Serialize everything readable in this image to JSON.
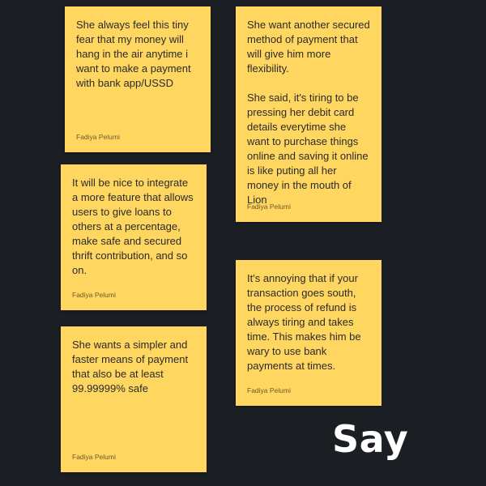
{
  "notes": [
    {
      "text": "She always feel this tiny fear that my money will hang in the air anytime i want to make a payment with bank app/USSD",
      "author": "Fadiya Pelumi"
    },
    {
      "text": "It will be nice to integrate a more feature that allows users to give loans to others at a percentage, make  safe and secured thrift contribution, and so on.",
      "author": "Fadiya Pelumi"
    },
    {
      "text": "She wants a simpler and faster means of payment that also be at least 99.99999% safe",
      "author": "Fadiya Pelumi"
    },
    {
      "text": "She want another secured method of payment that will give him more flexibility.\n\nShe said, it's tiring to be pressing her debit card details everytime she want to purchase things online and saving it online is like puting all her money in the mouth of Lion",
      "author": "Fadiya Pelumi"
    },
    {
      "text": "It's annoying that if your transaction goes south, the process of refund is always tiring and takes time. This makes him be wary to use bank payments at times.",
      "author": "Fadiya Pelumi"
    }
  ],
  "section_label": "Say",
  "colors": {
    "background": "#1b1e23",
    "note": "#ffd760",
    "text": "#2a2a2a",
    "label": "#ffffff"
  }
}
